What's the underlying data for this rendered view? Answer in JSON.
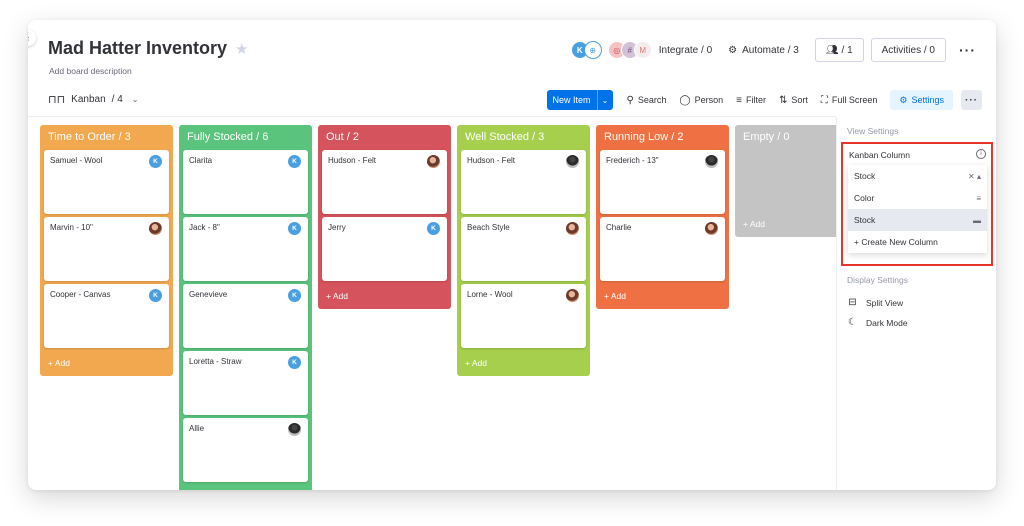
{
  "board": {
    "title": "Mad Hatter Inventory",
    "description_placeholder": "Add board description",
    "view": {
      "label": "Kanban",
      "count": "/ 4"
    }
  },
  "header": {
    "avatar_initial": "K",
    "integrate_label": "Integrate / 0",
    "automate_label": "Automate / 3",
    "members_label": "/ 1",
    "activities_label": "Activities / 0"
  },
  "toolbar": {
    "new_item": "New Item",
    "search": "Search",
    "person": "Person",
    "filter": "Filter",
    "sort": "Sort",
    "full_screen": "Full Screen",
    "settings": "Settings"
  },
  "columns": [
    {
      "title": "Time to Order / 3",
      "color": "#f2a84f",
      "add": "+ Add",
      "cards": [
        {
          "name": "Samuel - Wool",
          "avatar": "K"
        },
        {
          "name": "Marvin - 10\"",
          "avatar": "photo1"
        },
        {
          "name": "Cooper - Canvas",
          "avatar": "K"
        }
      ]
    },
    {
      "title": "Fully Stocked / 6",
      "color": "#5ac47d",
      "add": "+ Add",
      "cards": [
        {
          "name": "Clarita",
          "avatar": "K"
        },
        {
          "name": "Jack - 8\"",
          "avatar": "K"
        },
        {
          "name": "Genevieve",
          "avatar": "K"
        },
        {
          "name": "Loretta - Straw",
          "avatar": "K"
        },
        {
          "name": "Allie",
          "avatar": "photo2"
        }
      ]
    },
    {
      "title": "Out / 2",
      "color": "#d5535c",
      "add": "+ Add",
      "cards": [
        {
          "name": "Hudson - Felt",
          "avatar": "photo1"
        },
        {
          "name": "Jerry",
          "avatar": "K"
        }
      ]
    },
    {
      "title": "Well Stocked / 3",
      "color": "#a5cf4c",
      "add": "+ Add",
      "cards": [
        {
          "name": "Hudson - Felt",
          "avatar": "photo2"
        },
        {
          "name": "Beach Style",
          "avatar": "photo1"
        },
        {
          "name": "Lorne - Wool",
          "avatar": "photo1"
        }
      ]
    },
    {
      "title": "Running Low / 2",
      "color": "#ef7143",
      "add": "+ Add",
      "cards": [
        {
          "name": "Frederich - 13\"",
          "avatar": "photo2"
        },
        {
          "name": "Charlie",
          "avatar": "photo1"
        }
      ]
    },
    {
      "title": "Empty / 0",
      "color": "#c4c4c4",
      "add": "+ Add",
      "cards": []
    }
  ],
  "settings_panel": {
    "view_settings": "View Settings",
    "kanban_column_label": "Kanban Column",
    "selected_value": "Stock",
    "options": [
      "Color",
      "Stock"
    ],
    "create_new": "+ Create New Column",
    "display_settings": "Display Settings",
    "split_view": "Split View",
    "dark_mode": "Dark Mode"
  }
}
